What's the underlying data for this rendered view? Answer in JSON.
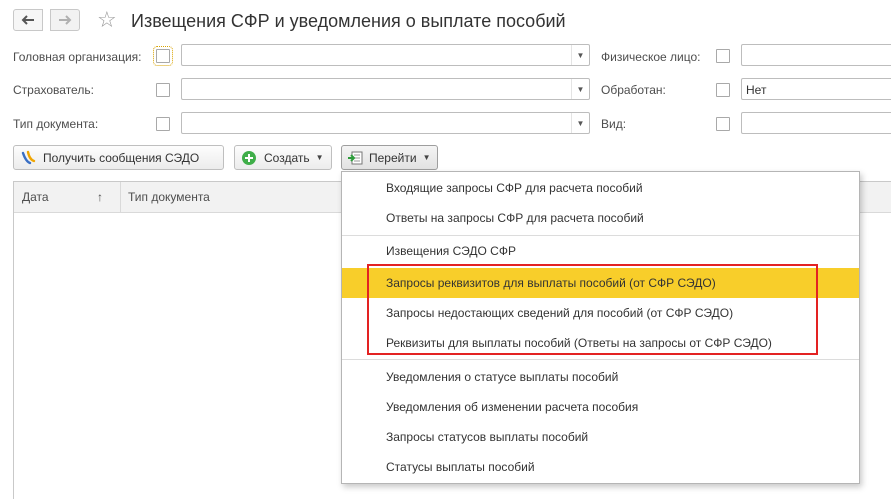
{
  "header": {
    "title": "Извещения СФР и уведомления о выплате пособий",
    "back_icon": "arrow-left-icon",
    "forward_icon": "arrow-right-icon",
    "favorite_icon": "star-icon"
  },
  "filters": {
    "head_org_label": "Головная организация:",
    "head_org_value": "",
    "insurer_label": "Страхователь:",
    "insurer_value": "",
    "doc_type_label": "Тип документа:",
    "doc_type_value": "",
    "person_label": "Физическое лицо:",
    "person_value": "",
    "processed_label": "Обработан:",
    "processed_value": "Нет",
    "kind_label": "Вид:",
    "kind_value": ""
  },
  "toolbar": {
    "get_messages_label": "Получить сообщения СЭДО",
    "create_label": "Создать",
    "goto_label": "Перейти"
  },
  "table": {
    "columns": [
      "Дата",
      "Тип документа"
    ],
    "sort_indicator": "↑"
  },
  "menu": {
    "items": [
      "Входящие запросы СФР для расчета пособий",
      "Ответы на запросы СФР для расчета пособий",
      "Извещения СЭДО СФР",
      "Запросы реквизитов для выплаты пособий (от СФР СЭДО)",
      "Запросы недостающих сведений для пособий (от СФР СЭДО)",
      "Реквизиты для выплаты пособий (Ответы на запросы от СФР СЭДО)",
      "Уведомления о статусе выплаты пособий",
      "Уведомления об изменении расчета пособия",
      "Запросы статусов выплаты пособий",
      "Статусы выплаты пособий"
    ],
    "highlighted_index": 3,
    "highlight_color": "#f8ce2a",
    "annotation_color": "#e32222"
  }
}
